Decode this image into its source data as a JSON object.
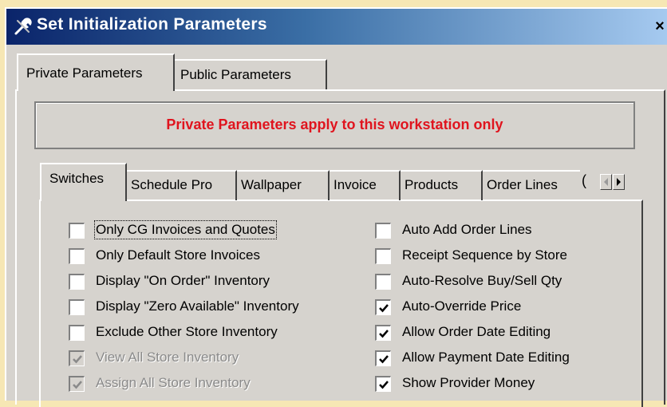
{
  "window": {
    "title": "Set Initialization Parameters",
    "close_label": "×"
  },
  "outer_tabs": [
    {
      "label": "Private Parameters",
      "active": true
    },
    {
      "label": "Public Parameters",
      "active": false
    }
  ],
  "banner": {
    "text": "Private Parameters apply to this workstation only",
    "color": "#e0141e"
  },
  "inner_tabs": [
    {
      "label": "Switches",
      "active": true
    },
    {
      "label": "Schedule Pro"
    },
    {
      "label": "Wallpaper"
    },
    {
      "label": "Invoice"
    },
    {
      "label": "Products"
    },
    {
      "label": "Order Lines"
    },
    {
      "label": "("
    }
  ],
  "left_options": [
    {
      "label": "Only CG Invoices and Quotes",
      "checked": false,
      "enabled": true
    },
    {
      "label": "Only Default Store Invoices",
      "checked": false,
      "enabled": true
    },
    {
      "label": "Display \"On Order\" Inventory",
      "checked": false,
      "enabled": true
    },
    {
      "label": "Display \"Zero Available\" Inventory",
      "checked": false,
      "enabled": true
    },
    {
      "label": "Exclude Other Store Inventory",
      "checked": false,
      "enabled": true
    },
    {
      "label": "View All Store Inventory",
      "checked": true,
      "enabled": false
    },
    {
      "label": "Assign All Store Inventory",
      "checked": true,
      "enabled": false
    }
  ],
  "right_options": [
    {
      "label": "Auto Add Order Lines",
      "checked": false,
      "enabled": true
    },
    {
      "label": "Receipt Sequence by Store",
      "checked": false,
      "enabled": true
    },
    {
      "label": "Auto-Resolve Buy/Sell Qty",
      "checked": false,
      "enabled": true
    },
    {
      "label": "Auto-Override Price",
      "checked": true,
      "enabled": true
    },
    {
      "label": "Allow Order Date Editing",
      "checked": true,
      "enabled": true
    },
    {
      "label": "Allow Payment Date Editing",
      "checked": true,
      "enabled": true
    },
    {
      "label": "Show Provider Money",
      "checked": true,
      "enabled": true
    }
  ],
  "icons": {
    "app": "wrench-tools-icon",
    "scroll_left": "scroll-left-arrow-icon",
    "scroll_right": "scroll-right-arrow-icon",
    "check": "checkmark-icon"
  }
}
